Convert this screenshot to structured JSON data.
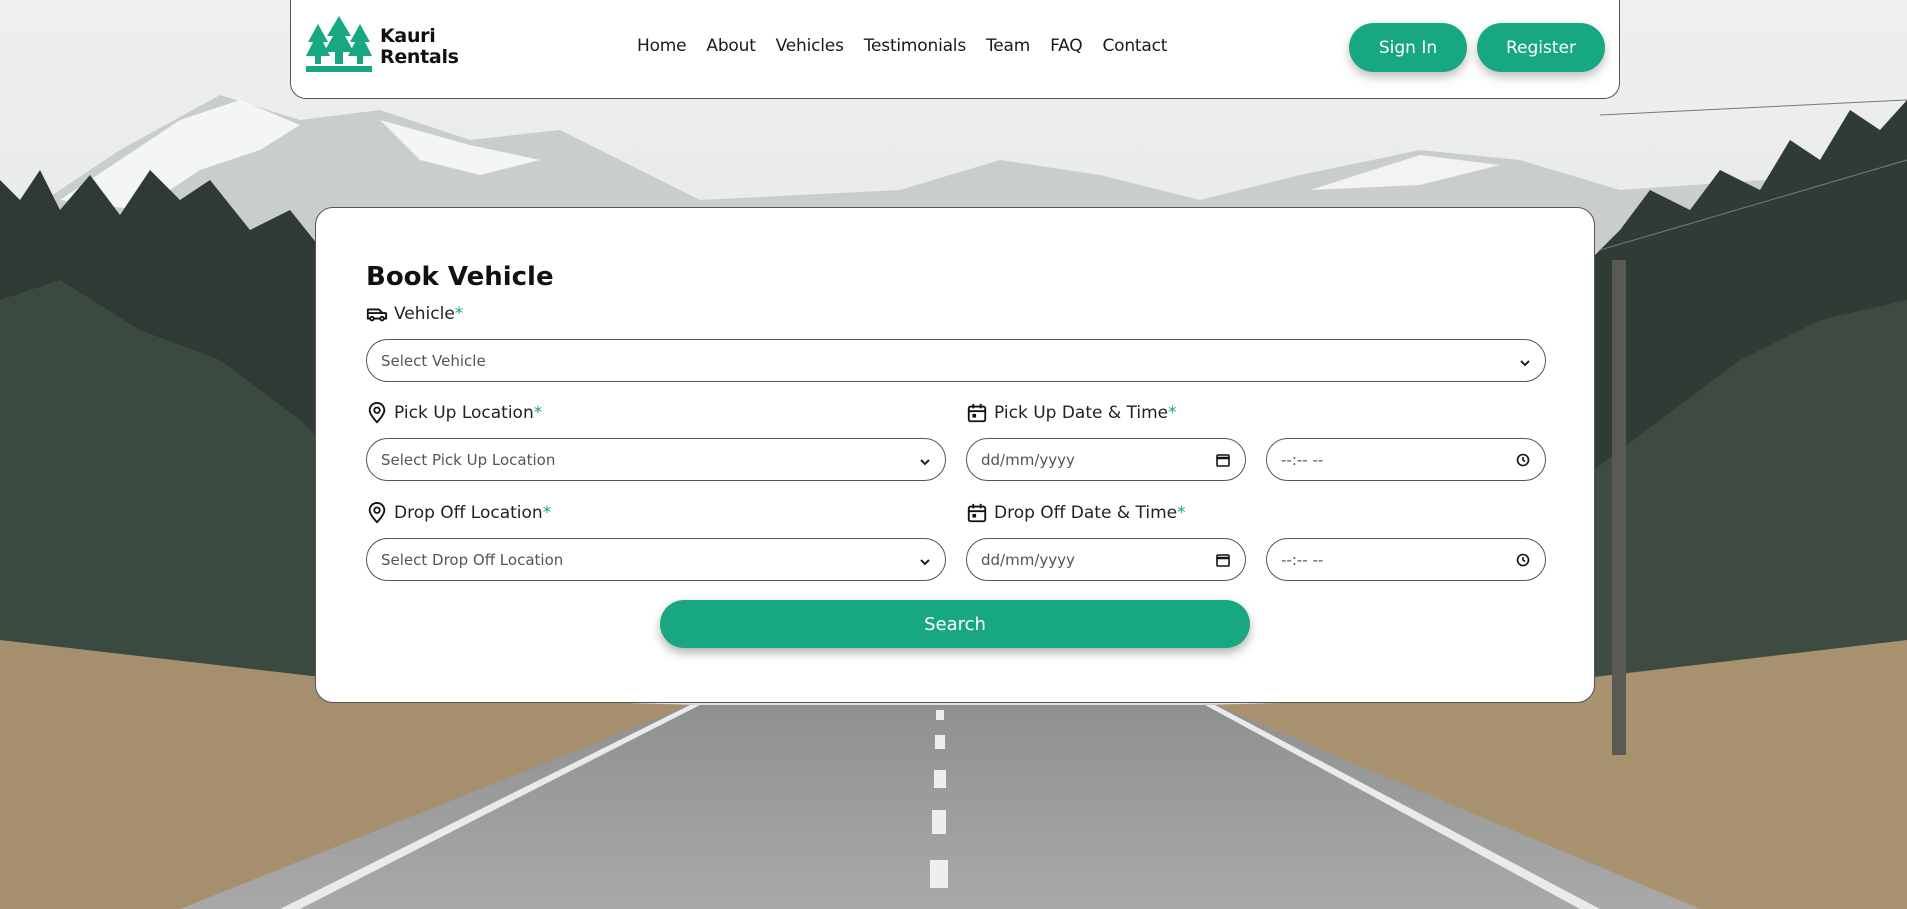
{
  "brand": {
    "line1": "Kauri",
    "line2": "Rentals",
    "logo_icon": "kauri-trees-logo",
    "accent": "#17a882"
  },
  "nav": {
    "links": [
      "Home",
      "About",
      "Vehicles",
      "Testimonials",
      "Team",
      "FAQ",
      "Contact"
    ],
    "sign_in": "Sign In",
    "register": "Register"
  },
  "booking": {
    "title": "Book Vehicle",
    "vehicle": {
      "label": "Vehicle",
      "required": "*",
      "placeholder": "Select Vehicle",
      "icon": "van-icon"
    },
    "pickup_location": {
      "label": "Pick Up Location",
      "required": "*",
      "placeholder": "Select Pick Up Location",
      "icon": "map-pin-icon"
    },
    "pickup_datetime": {
      "label": "Pick Up Date & Time",
      "required": "*",
      "date_placeholder": "dd/mm/yyyy",
      "time_placeholder": "--:-- --",
      "icon": "calendar-icon"
    },
    "dropoff_location": {
      "label": "Drop Off Location",
      "required": "*",
      "placeholder": "Select Drop Off Location",
      "icon": "map-pin-icon"
    },
    "dropoff_datetime": {
      "label": "Drop Off Date & Time",
      "required": "*",
      "date_placeholder": "dd/mm/yyyy",
      "time_placeholder": "--:-- --",
      "icon": "calendar-icon"
    },
    "search_label": "Search"
  }
}
